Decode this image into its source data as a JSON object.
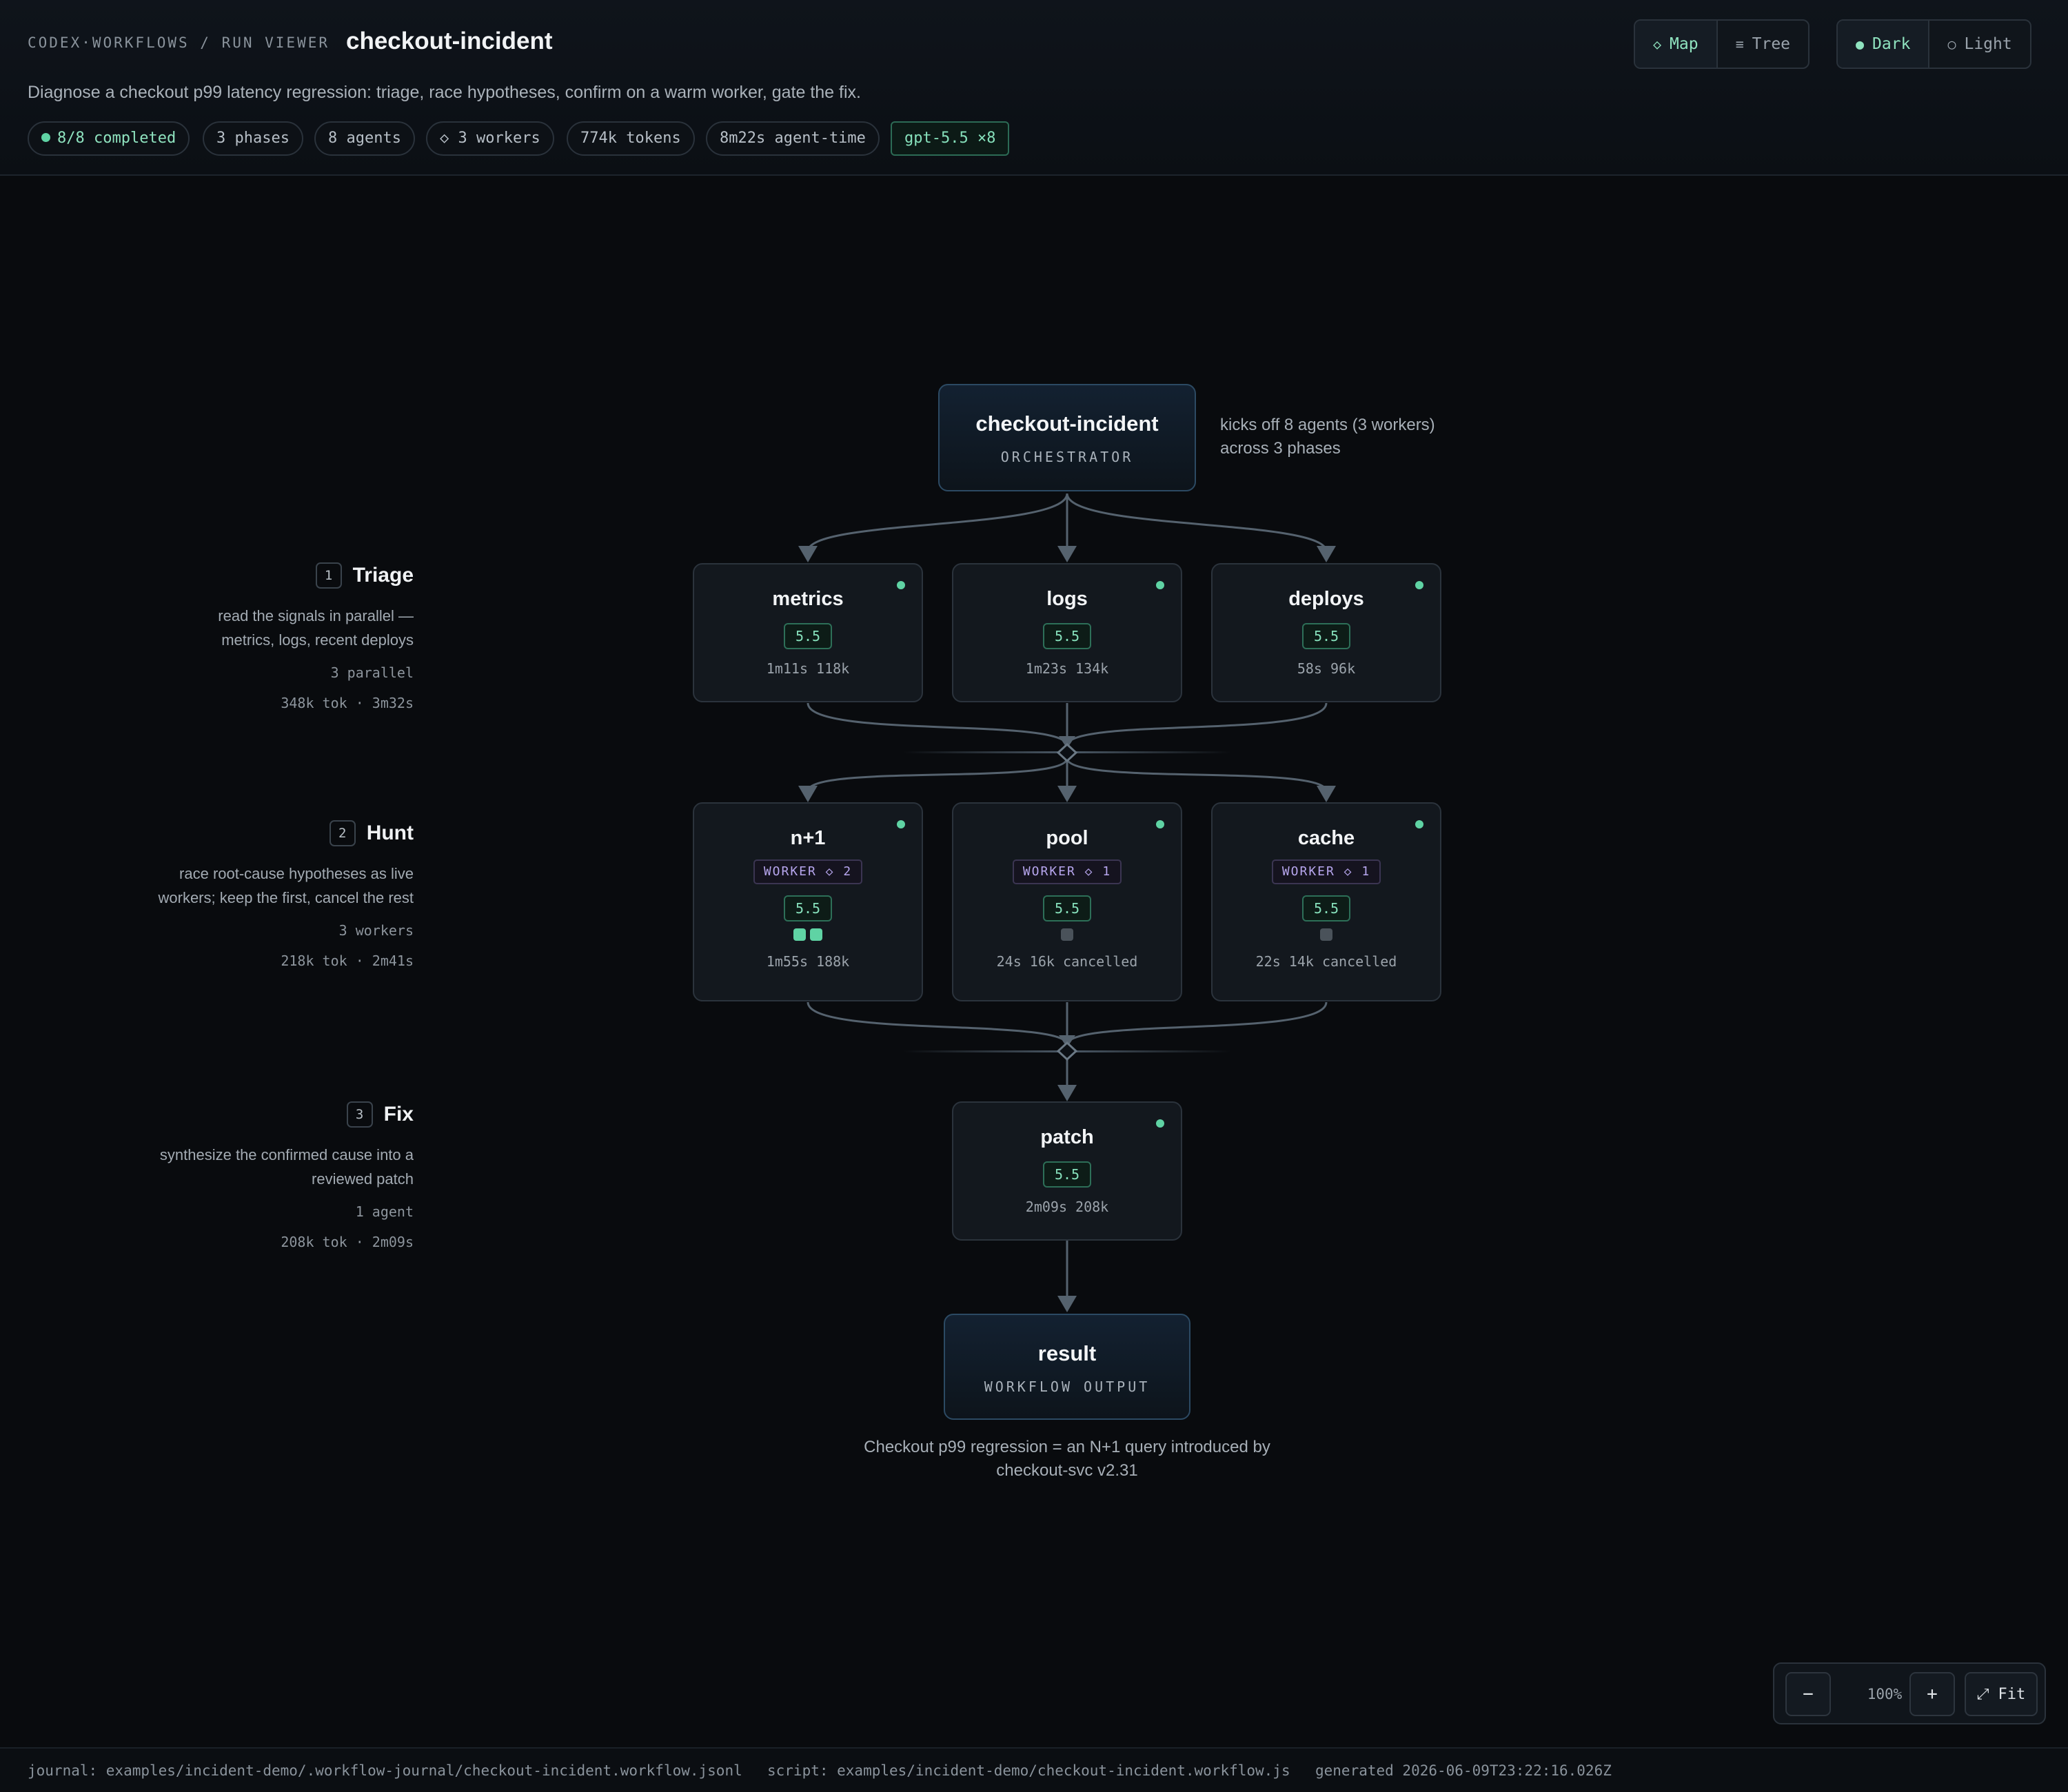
{
  "header": {
    "breadcrumb": "CODEX·WORKFLOWS / RUN VIEWER",
    "title": "checkout-incident",
    "description": "Diagnose a checkout p99 latency regression: triage, race hypotheses, confirm on a warm worker, gate the fix.",
    "pills": {
      "completed": "8/8 completed",
      "phases": "3 phases",
      "agents": "8 agents",
      "workers": "◇ 3 workers",
      "tokens": "774k tokens",
      "agent_time": "8m22s agent-time",
      "model": "gpt-5.5 ×8"
    },
    "view_toggle": {
      "map": "Map",
      "tree": "Tree",
      "active": "Map"
    },
    "theme_toggle": {
      "dark": "Dark",
      "light": "Light",
      "active": "Dark"
    }
  },
  "phases": [
    {
      "num": "1",
      "name": "Triage",
      "desc": "read the signals in parallel — metrics, logs, recent deploys",
      "meta": "3 parallel",
      "stats": "348k tok · 3m32s"
    },
    {
      "num": "2",
      "name": "Hunt",
      "desc": "race root-cause hypotheses as live workers; keep the first, cancel the rest",
      "meta": "3 workers",
      "stats": "218k tok · 2m41s"
    },
    {
      "num": "3",
      "name": "Fix",
      "desc": "synthesize the confirmed cause into a reviewed patch",
      "meta": "1 agent",
      "stats": "208k tok · 2m09s"
    }
  ],
  "orchestrator": {
    "name": "checkout-incident",
    "role": "ORCHESTRATOR",
    "note_line1": "kicks off 8 agents (3 workers)",
    "note_line2": "across 3 phases"
  },
  "nodes": {
    "metrics": {
      "name": "metrics",
      "model": "5.5",
      "stats": "1m11s 118k"
    },
    "logs": {
      "name": "logs",
      "model": "5.5",
      "stats": "1m23s 134k"
    },
    "deploys": {
      "name": "deploys",
      "model": "5.5",
      "stats": "58s 96k"
    },
    "n1": {
      "name": "n+1",
      "worker": "WORKER ◇ 2",
      "model": "5.5",
      "stats": "1m55s 188k"
    },
    "pool": {
      "name": "pool",
      "worker": "WORKER ◇ 1",
      "model": "5.5",
      "stats": "24s 16k cancelled"
    },
    "cache": {
      "name": "cache",
      "worker": "WORKER ◇ 1",
      "model": "5.5",
      "stats": "22s 14k cancelled"
    },
    "patch": {
      "name": "patch",
      "model": "5.5",
      "stats": "2m09s 208k"
    }
  },
  "result": {
    "name": "result",
    "role": "WORKFLOW OUTPUT",
    "summary_line1": "Checkout p99 regression = an N+1 query introduced by",
    "summary_line2": "checkout-svc v2.31"
  },
  "zoom": {
    "minus": "−",
    "level": "100%",
    "plus": "+",
    "fit": "⤢ Fit"
  },
  "footer": {
    "journal": "journal: examples/incident-demo/.workflow-journal/checkout-incident.workflow.jsonl",
    "script": "script: examples/incident-demo/checkout-incident.workflow.js",
    "generated": "generated 2026-06-09T23:22:16.026Z"
  },
  "colors": {
    "accent": "#5fd3a4",
    "worker": "#b7a6ee",
    "background": "#090b0e"
  }
}
